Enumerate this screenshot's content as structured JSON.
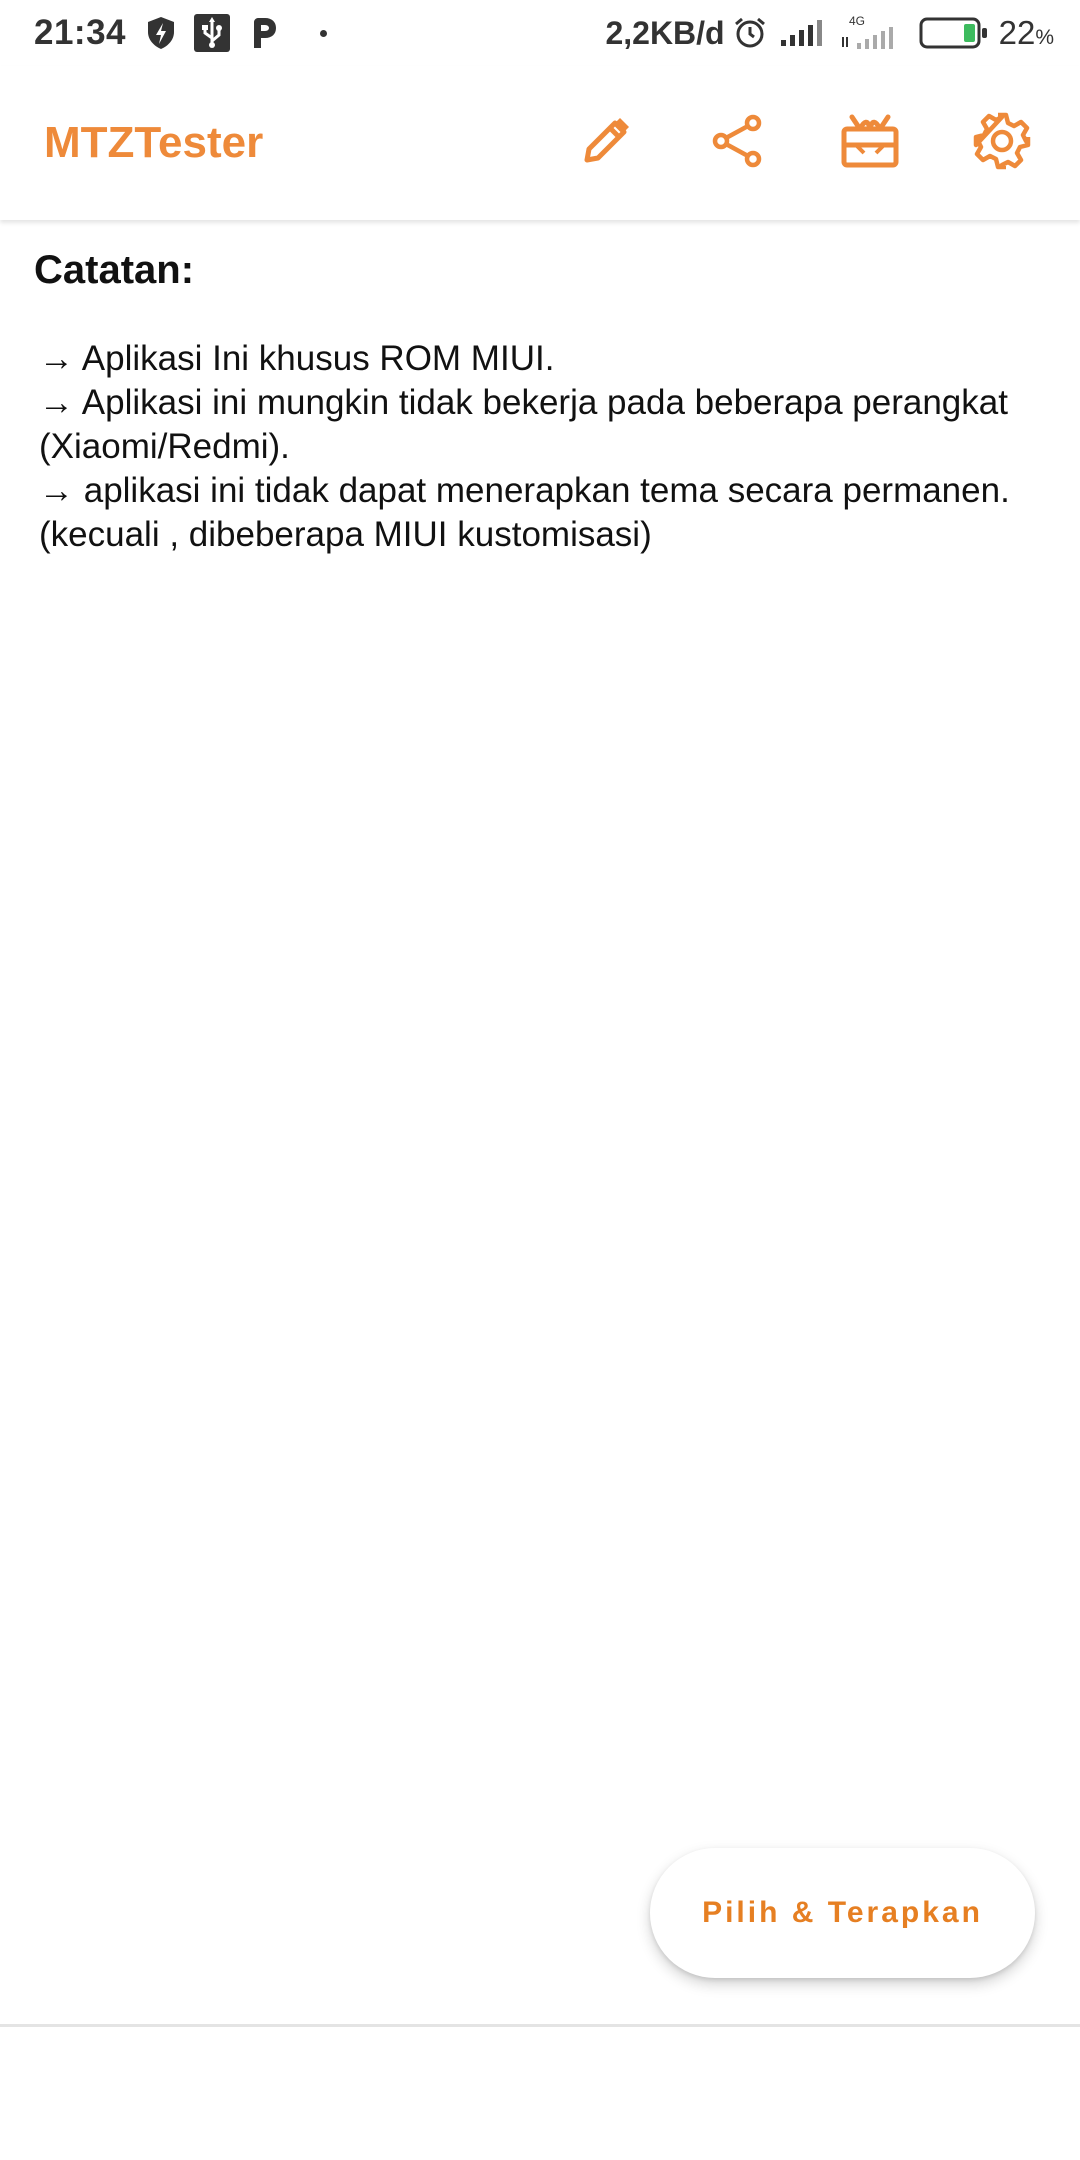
{
  "status_bar": {
    "time": "21:34",
    "speed": "2,2KB/d",
    "network": "4G",
    "battery_percent": "22",
    "battery_unit": "%",
    "battery_level": 0.22,
    "icons": [
      "shield-bolt-icon",
      "usb-icon",
      "parking-icon",
      "dot-icon",
      "alarm-icon",
      "signal-icon",
      "signal-4g-icon",
      "battery-icon"
    ]
  },
  "app_bar": {
    "title": "MTZTester",
    "accent_color": "#ee8a3a",
    "actions": [
      {
        "name": "edit",
        "icon": "pencil-icon"
      },
      {
        "name": "share",
        "icon": "share-icon"
      },
      {
        "name": "gift",
        "icon": "gift-icon"
      },
      {
        "name": "settings",
        "icon": "gear-icon"
      }
    ]
  },
  "notes": {
    "title": "Catatan:",
    "items": [
      "→ Aplikasi Ini khusus ROM  MIUI.",
      "→ Aplikasi ini mungkin tidak bekerja pada beberapa perangkat (Xiaomi/Redmi).",
      "→ aplikasi ini tidak dapat menerapkan tema secara permanen. (kecuali , dibeberapa MIUI kustomisasi)"
    ]
  },
  "fab": {
    "label": "Pilih & Terapkan",
    "color": "#e67f22"
  }
}
